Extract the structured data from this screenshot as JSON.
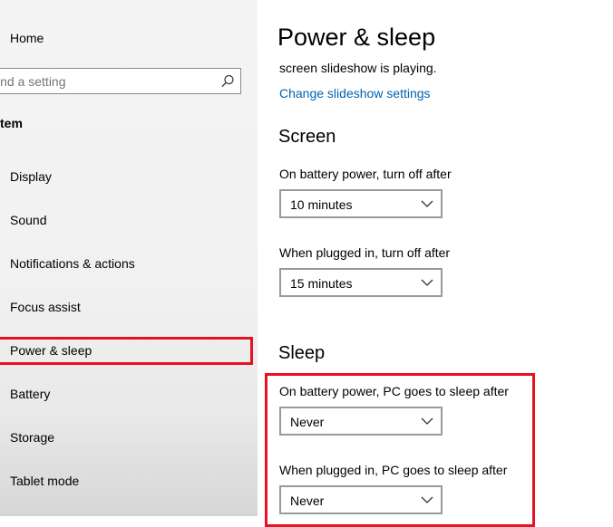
{
  "sidebar": {
    "home_label": "Home",
    "search_placeholder": "ind a setting",
    "section_label": "tem",
    "items": [
      {
        "label": "Display"
      },
      {
        "label": "Sound"
      },
      {
        "label": "Notifications & actions"
      },
      {
        "label": "Focus assist"
      },
      {
        "label": "Power & sleep"
      },
      {
        "label": "Battery"
      },
      {
        "label": "Storage"
      },
      {
        "label": "Tablet mode"
      }
    ]
  },
  "main": {
    "title": "Power & sleep",
    "slideshow_text": "screen slideshow is playing.",
    "slideshow_link": "Change slideshow settings",
    "screen": {
      "heading": "Screen",
      "battery_label": "On battery power, turn off after",
      "battery_value": "10 minutes",
      "plugged_label": "When plugged in, turn off after",
      "plugged_value": "15 minutes"
    },
    "sleep": {
      "heading": "Sleep",
      "battery_label": "On battery power, PC goes to sleep after",
      "battery_value": "Never",
      "plugged_label": "When plugged in, PC goes to sleep after",
      "plugged_value": "Never"
    }
  },
  "colors": {
    "highlight": "#e81123",
    "link": "#0063b1"
  }
}
